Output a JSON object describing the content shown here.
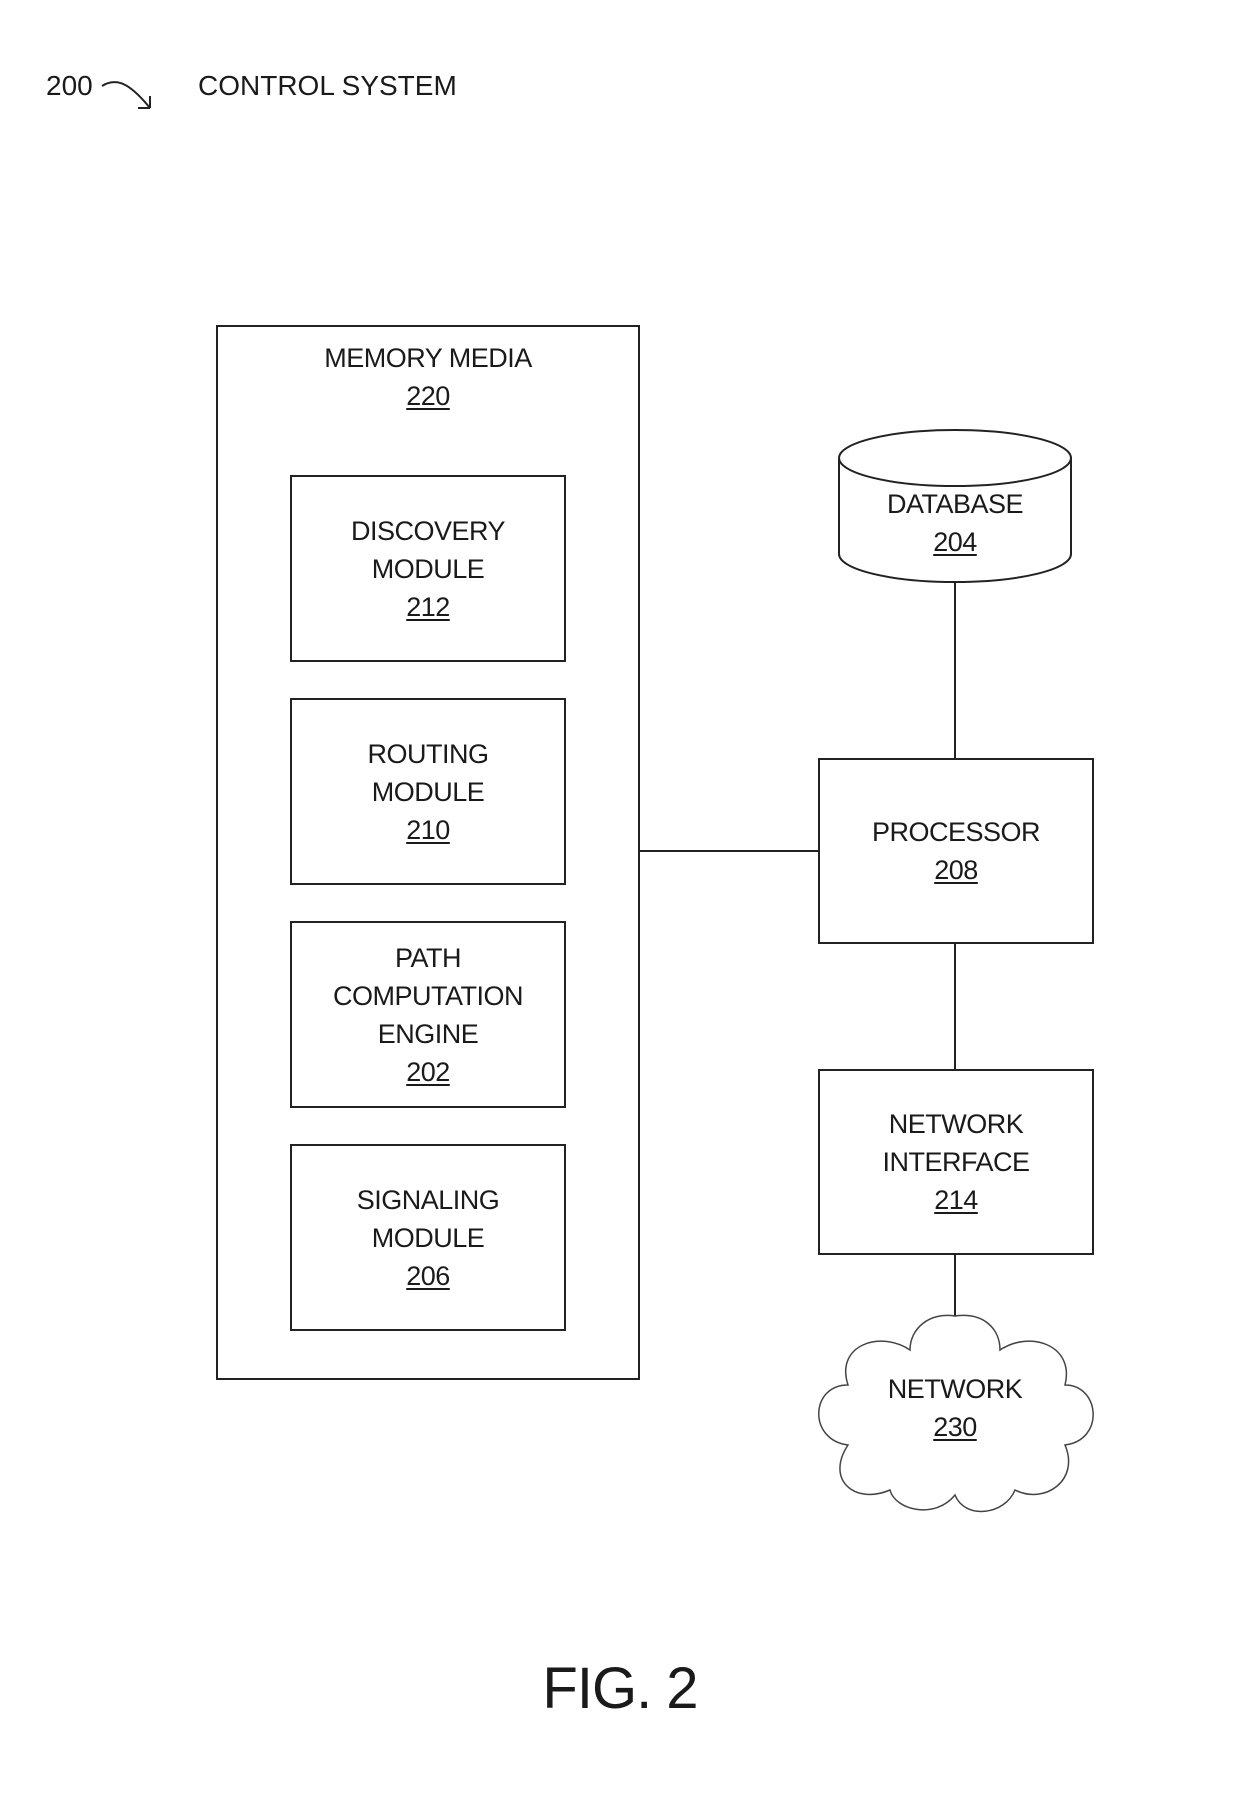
{
  "figure": {
    "reference": "200",
    "title": "CONTROL SYSTEM",
    "caption": "FIG. 2"
  },
  "memory_media": {
    "label": "MEMORY MEDIA",
    "ref": "220",
    "modules": [
      {
        "lines": [
          "DISCOVERY",
          "MODULE"
        ],
        "ref": "212"
      },
      {
        "lines": [
          "ROUTING",
          "MODULE"
        ],
        "ref": "210"
      },
      {
        "lines": [
          "PATH",
          "COMPUTATION",
          "ENGINE"
        ],
        "ref": "202"
      },
      {
        "lines": [
          "SIGNALING",
          "MODULE"
        ],
        "ref": "206"
      }
    ]
  },
  "database": {
    "label": "DATABASE",
    "ref": "204"
  },
  "processor": {
    "label": "PROCESSOR",
    "ref": "208"
  },
  "network_interface": {
    "lines": [
      "NETWORK",
      "INTERFACE"
    ],
    "ref": "214"
  },
  "network": {
    "label": "NETWORK",
    "ref": "230"
  }
}
